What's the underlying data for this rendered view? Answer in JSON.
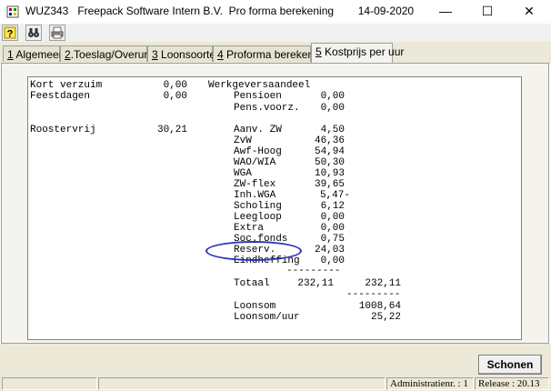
{
  "window": {
    "title": "WUZ343   Freepack Software Intern B.V.  Pro forma berekening        14-09-2020",
    "minimize": "—",
    "maximize": "☐",
    "close": "✕"
  },
  "toolbar": [
    "help-icon",
    "binoculars-icon",
    "printer-icon"
  ],
  "tabs": [
    {
      "key": "1",
      "label": " Algemeen"
    },
    {
      "key": "2",
      "label": ".Toeslag/Overuren"
    },
    {
      "key": "3",
      "label": " Loonsoorten"
    },
    {
      "key": "4",
      "label": " Proforma berekening"
    },
    {
      "key": "5",
      "label": " Kostprijs per uur"
    }
  ],
  "report": {
    "left_rows": [
      {
        "label": "Kort verzuim",
        "value": "0,00"
      },
      {
        "label": "Feestdagen",
        "value": "0,00"
      },
      {
        "label": "Roostervrij",
        "value": "30,21"
      }
    ],
    "section_header": "Werkgeversaandeel",
    "right_rows": [
      {
        "label": "Pensioen",
        "value": "0,00"
      },
      {
        "label": "Pens.voorz.",
        "value": "0,00"
      },
      {
        "label": "Aanv. ZW",
        "value": "4,50"
      },
      {
        "label": "ZvW",
        "value": "46,36"
      },
      {
        "label": "Awf-Hoog",
        "value": "54,94"
      },
      {
        "label": "WAO/WIA",
        "value": "50,30"
      },
      {
        "label": "WGA",
        "value": "10,93"
      },
      {
        "label": "ZW-flex",
        "value": "39,65"
      },
      {
        "label": "Inh.WGA",
        "value": "5,47-"
      },
      {
        "label": "Scholing",
        "value": "6,12"
      },
      {
        "label": "Leegloop",
        "value": "0,00"
      },
      {
        "label": "Extra",
        "value": "0,00"
      },
      {
        "label": "Soc.fonds",
        "value": "0,75"
      },
      {
        "label": "Reserv.",
        "value": "24,03"
      },
      {
        "label": "Eindheffing",
        "value": "0,00"
      }
    ],
    "separator1": "---------",
    "totaal": {
      "label": "Totaal",
      "value1": "232,11",
      "value2": "232,11"
    },
    "separator2": "---------",
    "loonsom": {
      "label": "Loonsom",
      "value": "1008,64"
    },
    "loonsom_uur": {
      "label": "Loonsom/uur",
      "value": "25,22"
    }
  },
  "buttons": {
    "schonen": "Schonen"
  },
  "status": {
    "administratie": "Administratienr. :  1",
    "release": "Release : 20.13"
  }
}
